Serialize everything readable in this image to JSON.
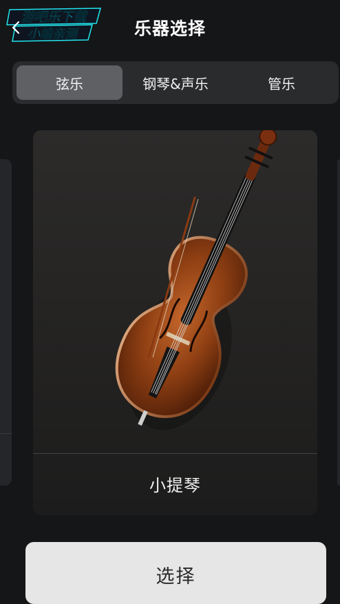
{
  "watermark": {
    "line1": "游吧乐下载",
    "line2": "小编亲测"
  },
  "header": {
    "back_icon": "chevron-left-icon",
    "title": "乐器选择"
  },
  "tabs": [
    {
      "label": "弦乐",
      "active": true
    },
    {
      "label": "钢琴&声乐",
      "active": false
    },
    {
      "label": "管乐",
      "active": false
    }
  ],
  "carousel": {
    "current": {
      "name": "小提琴",
      "image": "cello-image"
    }
  },
  "actions": {
    "select_label": "选择"
  },
  "colors": {
    "background": "#151617",
    "card": "#25262a",
    "active_tab": "#5e6064",
    "button": "#e6e6e6",
    "watermark_cyan": "#22e6f0"
  }
}
